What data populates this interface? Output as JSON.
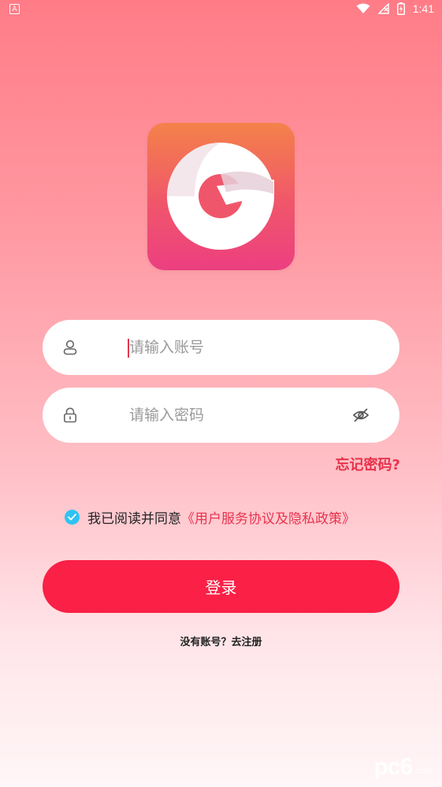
{
  "status_bar": {
    "left_badge": "A",
    "time": "1:41"
  },
  "login": {
    "account_placeholder": "请输入账号",
    "password_placeholder": "请输入密码",
    "forgot_password": "忘记密码?",
    "agreement_prefix": "我已阅读并同意",
    "agreement_link": "《用户服务协议及隐私政策》",
    "agreement_checked": true,
    "login_button": "登录",
    "register_link": "没有账号？去注册"
  },
  "watermark": {
    "main": "pc6",
    "sub": ".com"
  },
  "colors": {
    "accent": "#fa2046",
    "link": "#e8334d",
    "check": "#2ec3f2"
  }
}
